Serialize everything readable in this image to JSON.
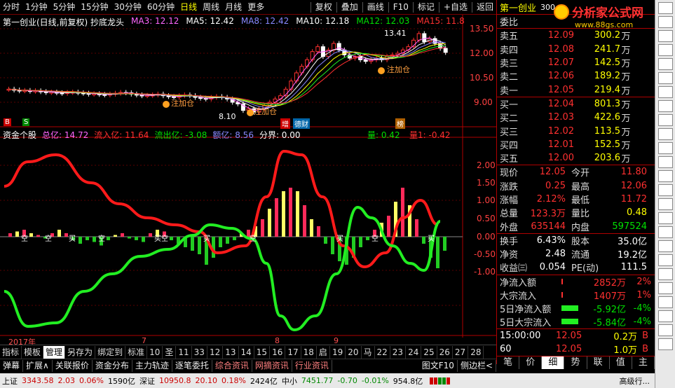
{
  "toolbar": {
    "items": [
      "分时",
      "1分钟",
      "5分钟",
      "15分钟",
      "30分钟",
      "60分钟",
      "日线",
      "周线",
      "月线",
      "更多"
    ],
    "active": "日线",
    "right": [
      "复权",
      "叠加",
      "画线",
      "F10",
      "标记",
      "+自选",
      "返回"
    ]
  },
  "chart_header": {
    "title": "第一创业(日线,前复权) 抄底龙头",
    "ma3": "MA3: 12.12",
    "ma5": "MA5: 12.42",
    "ma8": "MA8: 12.42",
    "ma10": "MA10: 12.18",
    "ma12": "MA12: 12.03",
    "ma15": "MA15: 11.8"
  },
  "price_axis": [
    "13.50",
    "12.00",
    "10.50",
    "9.00"
  ],
  "annotations": {
    "high": "13.41",
    "low": "8.10",
    "add1": "注加仓",
    "add2": "注加仓",
    "add3": "注加仓",
    "tag_zeng": "增",
    "tag_chaocai": "德财",
    "tag_bang": "榜",
    "flag_b": "B",
    "flag_s": "S"
  },
  "indicator_header": {
    "name": "资金个股",
    "total": "总亿: 14.72",
    "inflow": "流入亿: 11.64",
    "outflow": "流出亿: -3.08",
    "amount": "额亿: 8.56",
    "boundary": "分界: 0.00",
    "vol": "量: 0.42",
    "vol1": "量1: -0.42"
  },
  "indicator_axis": [
    "2.00",
    "1.50",
    "1.00",
    "0.50",
    "0.00",
    "-0.50",
    "-1.00"
  ],
  "indicator_labels": [
    "空",
    "空",
    "买",
    "空",
    "买空",
    "买",
    "空",
    "买",
    "空",
    "买",
    "空",
    "空"
  ],
  "date_axis": {
    "year": "2017年",
    "m7": "7",
    "m8": "8",
    "m9": "9"
  },
  "bottom_tabs": [
    "指标",
    "模板",
    "管理",
    "另存为",
    "绑定到",
    "标准",
    "10",
    "圣",
    "11",
    "33",
    "12",
    "13",
    "14",
    "15",
    "16",
    "17",
    "18",
    "启",
    "19",
    "20",
    "马",
    "22",
    "23",
    "24",
    "25",
    "26",
    "27",
    "28"
  ],
  "bottom_tabs_active": "管理",
  "bottom_bar2": [
    "弹幕",
    "扩展∧",
    "关联报价",
    "资金分布",
    "主力轨迹",
    "逐笔委托",
    "综合资讯",
    "网摘资讯",
    "行业资讯"
  ],
  "bottom_bar2_right": [
    "图文F10",
    "侧边栏<"
  ],
  "right_header": {
    "stock": "第一创业",
    "code": "300"
  },
  "order_book": {
    "wei_bi": "委比",
    "sells": [
      {
        "label": "卖五",
        "price": "12.09",
        "vol": "300.2",
        "unit": "万"
      },
      {
        "label": "卖四",
        "price": "12.08",
        "vol": "241.7",
        "unit": "万"
      },
      {
        "label": "卖三",
        "price": "12.07",
        "vol": "142.5",
        "unit": "万"
      },
      {
        "label": "卖二",
        "price": "12.06",
        "vol": "189.2",
        "unit": "万"
      },
      {
        "label": "卖一",
        "price": "12.05",
        "vol": "219.4",
        "unit": "万"
      }
    ],
    "buys": [
      {
        "label": "买一",
        "price": "12.04",
        "vol": "801.3",
        "unit": "万"
      },
      {
        "label": "买二",
        "price": "12.03",
        "vol": "422.6",
        "unit": "万"
      },
      {
        "label": "买三",
        "price": "12.02",
        "vol": "113.5",
        "unit": "万"
      },
      {
        "label": "买四",
        "price": "12.01",
        "vol": "152.5",
        "unit": "万"
      },
      {
        "label": "买五",
        "price": "12.00",
        "vol": "203.6",
        "unit": "万"
      }
    ]
  },
  "quote": [
    {
      "l1": "现价",
      "v1": "12.05",
      "l2": "今开",
      "v2": "11.80"
    },
    {
      "l1": "涨跌",
      "v1": "0.25",
      "l2": "最高",
      "v2": "12.06"
    },
    {
      "l1": "涨幅",
      "v1": "2.12%",
      "l2": "最低",
      "v2": "11.72"
    },
    {
      "l1": "总量",
      "v1": "123.3万",
      "l2": "量比",
      "v2": "0.48"
    },
    {
      "l1": "外盘",
      "v1": "635144",
      "l2": "内盘",
      "v2": "597524"
    }
  ],
  "stats": [
    {
      "l1": "换手",
      "v1": "6.43%",
      "l2": "股本",
      "v2": "35.0亿"
    },
    {
      "l1": "净资",
      "v1": "2.48",
      "l2": "流通",
      "v2": "19.2亿"
    },
    {
      "l1": "收益㈢",
      "v1": "0.054",
      "l2": "PE(动)",
      "v2": "111.5"
    }
  ],
  "flows": [
    {
      "label": "净流入额",
      "val": "2852万",
      "pct": "2%"
    },
    {
      "label": "大宗流入",
      "val": "1407万",
      "pct": "1%"
    },
    {
      "label": "5日净流入额",
      "val": "-5.92亿",
      "pct": "-4%"
    },
    {
      "label": "5日大宗流入",
      "val": "-5.84亿",
      "pct": "-4%"
    }
  ],
  "ticks": [
    {
      "time": "15:00:00",
      "price": "12.05",
      "vol": "0.2万",
      "side": "B"
    },
    {
      "time": "60",
      "price": "12.05",
      "vol": "1.0万",
      "side": "B"
    }
  ],
  "right_tabs": [
    "笔",
    "价",
    "细",
    "势",
    "联",
    "值",
    "主"
  ],
  "right_tabs_active": "细",
  "status": {
    "sh_label": "上证",
    "sh": "3343.58",
    "sh_chg": "2.03",
    "sh_pct": "0.06%",
    "sh_amt": "1590亿",
    "sz_label": "深证",
    "sz": "10950.8",
    "sz_chg": "20.10",
    "sz_pct": "0.18%",
    "sz_amt": "2424亿",
    "zx_label": "中小",
    "zx": "7451.77",
    "zx_chg": "-0.70",
    "zx_pct": "-0.01%",
    "zx_amt": "954.8亿",
    "right": "高级行..."
  },
  "logo": {
    "text": "分析家公式网",
    "url": "www.88gs.com"
  }
}
